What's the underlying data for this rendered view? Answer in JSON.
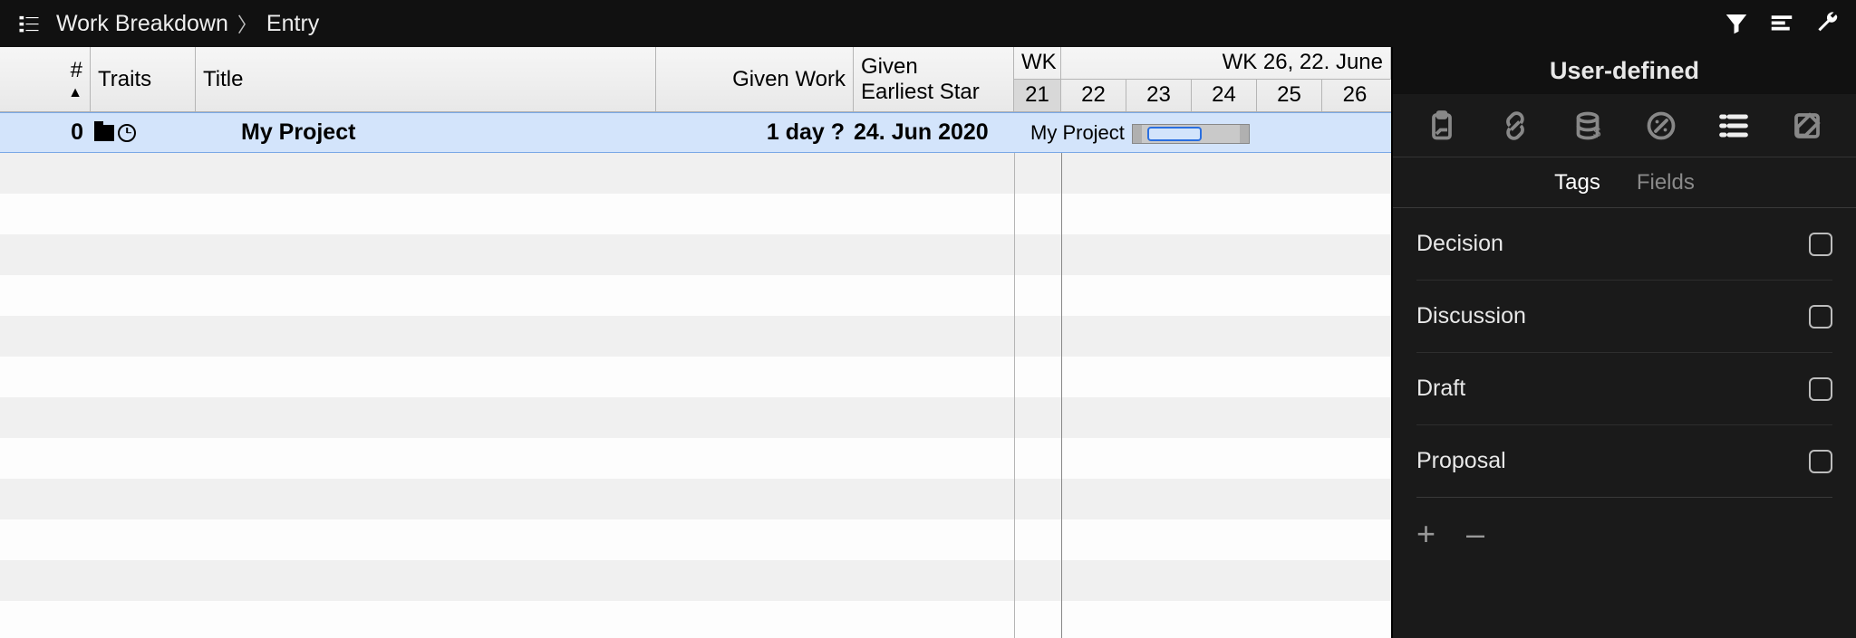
{
  "breadcrumb": {
    "icon": "outline-icon",
    "part1": "Work Breakdown",
    "part2": "Entry"
  },
  "toolbar_icons": [
    "filter-icon",
    "alignment-icon",
    "wrench-icon"
  ],
  "columns": {
    "number": "#",
    "traits": "Traits",
    "title": "Title",
    "given_work": "Given Work",
    "given_earliest_start_l1": "Given",
    "given_earliest_start_l2": "Earliest Star"
  },
  "timescale": {
    "week_left_label": "WK",
    "week_right_label": "WK 26, 22. June",
    "days": [
      "21",
      "22",
      "23",
      "24",
      "25",
      "26"
    ],
    "today_index": 0
  },
  "row": {
    "number": "0",
    "title": "My Project",
    "given_work": "1 day ?",
    "given_start": "24. Jun 2020",
    "gantt_label": "My Project"
  },
  "inspector": {
    "title": "User-defined",
    "icons": [
      "clipboard-icon",
      "link-icon",
      "cost-icon",
      "percent-icon",
      "list-icon",
      "note-icon"
    ],
    "tabs": {
      "tags": "Tags",
      "fields": "Fields",
      "active": "tags"
    },
    "tags": [
      {
        "label": "Decision",
        "checked": false
      },
      {
        "label": "Discussion",
        "checked": false
      },
      {
        "label": "Draft",
        "checked": false
      },
      {
        "label": "Proposal",
        "checked": false
      }
    ],
    "add_label": "+",
    "remove_label": "–"
  }
}
